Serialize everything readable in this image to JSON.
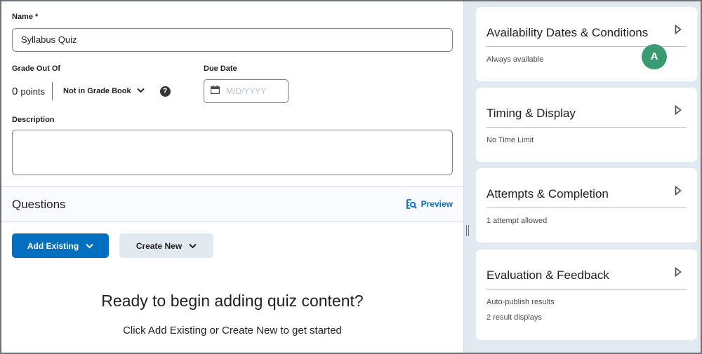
{
  "form": {
    "name_label": "Name *",
    "name_value": "Syllabus Quiz",
    "grade_label": "Grade Out Of",
    "grade_value": "0",
    "grade_unit": "points",
    "gradebook_option": "Not in Grade Book",
    "help_glyph": "?",
    "due_date_label": "Due Date",
    "due_date_placeholder": "M/D/YYYY",
    "description_label": "Description",
    "description_value": ""
  },
  "questions": {
    "title": "Questions",
    "preview_label": "Preview",
    "add_existing_label": "Add Existing",
    "create_new_label": "Create New",
    "empty_title": "Ready to begin adding quiz content?",
    "empty_subtitle": "Click Add Existing or Create New to get started"
  },
  "colors": {
    "primary": "#006fbf",
    "avatar": "#3a9b73",
    "panel_bg": "#e3e9f1"
  },
  "sidebar": {
    "cards": [
      {
        "title": "Availability Dates & Conditions",
        "lines": [
          "Always available"
        ],
        "avatar": "A"
      },
      {
        "title": "Timing & Display",
        "lines": [
          "No Time Limit"
        ]
      },
      {
        "title": "Attempts & Completion",
        "lines": [
          "1 attempt allowed"
        ]
      },
      {
        "title": "Evaluation & Feedback",
        "lines": [
          "Auto-publish results",
          "2 result displays"
        ]
      }
    ]
  }
}
